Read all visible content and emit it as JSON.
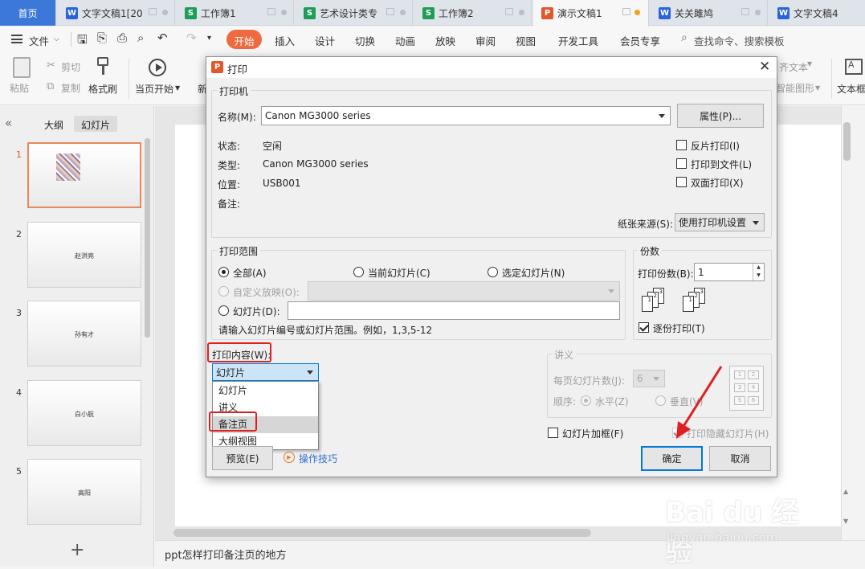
{
  "tabs": [
    {
      "label": "首页",
      "icon": "",
      "icon_color": "#2e6fd6"
    },
    {
      "label": "文字文稿1[20",
      "icon": "W",
      "icon_color": "#2b64d9"
    },
    {
      "label": "工作簿1",
      "icon": "S",
      "icon_color": "#1e9c58"
    },
    {
      "label": "艺术设计类专",
      "icon": "S",
      "icon_color": "#1e9c58"
    },
    {
      "label": "工作簿2",
      "icon": "S",
      "icon_color": "#1e9c58"
    },
    {
      "label": "演示文稿1",
      "icon": "P",
      "icon_color": "#e2582c"
    },
    {
      "label": "关关雎鸠",
      "icon": "W",
      "icon_color": "#2b64d9"
    },
    {
      "label": "文字文稿4",
      "icon": "W",
      "icon_color": "#2b64d9"
    }
  ],
  "menu": {
    "file": "文件",
    "items": [
      "开始",
      "插入",
      "设计",
      "切换",
      "动画",
      "放映",
      "审阅",
      "视图",
      "开发工具",
      "会员专享"
    ],
    "search_placeholder": "查找命令、搜索模板"
  },
  "ribbon": {
    "paste": "粘贴",
    "cut": "剪切",
    "copy": "复制",
    "format_painter": "格式刷",
    "play_from_current": "当页开始",
    "new_truncated": "新",
    "align_text": "齐文本",
    "smart_shape": "智能图形",
    "textbox": "文本框"
  },
  "left_panel": {
    "tab_outline": "大纲",
    "tab_slides": "幻灯片",
    "slides": [
      {
        "num": "1",
        "text": ""
      },
      {
        "num": "2",
        "text": "赵洪亮"
      },
      {
        "num": "3",
        "text": "孙有才"
      },
      {
        "num": "4",
        "text": "白小航"
      },
      {
        "num": "5",
        "text": "高阳"
      }
    ]
  },
  "status_bar": {
    "notes_text": "ppt怎样打印备注页的地方"
  },
  "dialog": {
    "title": "打印",
    "printer_group": "打印机",
    "name_label": "名称(M):",
    "printer_name": "Canon MG3000 series",
    "properties_button": "属性(P)...",
    "status_label": "状态:",
    "status_value": "空闲",
    "type_label": "类型:",
    "type_value": "Canon MG3000 series",
    "location_label": "位置:",
    "location_value": "USB001",
    "comment_label": "备注:",
    "reverse_print": "反片打印(I)",
    "print_to_file": "打印到文件(L)",
    "duplex_print": "双面打印(X)",
    "paper_source_label": "纸张来源(S):",
    "paper_source_value": "使用打印机设置",
    "range_group": "打印范围",
    "range_all": "全部(A)",
    "range_current": "当前幻灯片(C)",
    "range_selection": "选定幻灯片(N)",
    "range_custom": "自定义放映(O):",
    "range_slides": "幻灯片(D):",
    "range_hint": "请输入幻灯片编号或幻灯片范围。例如，1,3,5-12",
    "copies_group": "份数",
    "copies_label": "打印份数(B):",
    "copies_value": "1",
    "collate": "逐份打印(T)",
    "print_content_label": "打印内容(W):",
    "print_content_value": "幻灯片",
    "dropdown_options": [
      "幻灯片",
      "讲义",
      "备注页",
      "大纲视图"
    ],
    "handout_group": "讲义",
    "slides_per_page_label": "每页幻灯片数(J):",
    "slides_per_page_value": "6",
    "order_label": "顺序:",
    "order_horizontal": "水平(Z)",
    "order_vertical": "垂直(V)",
    "frame_slides": "幻灯片加框(F)",
    "print_hidden": "打印隐藏幻灯片(H)",
    "preview_button": "预览(E)",
    "tips_link": "操作技巧",
    "ok_button": "确定",
    "cancel_button": "取消",
    "accent_color": "#0078d7",
    "annotation_color": "#e02020"
  },
  "watermark": {
    "brand": "Bai du 经验",
    "url": "jingyan.baidu.com"
  }
}
